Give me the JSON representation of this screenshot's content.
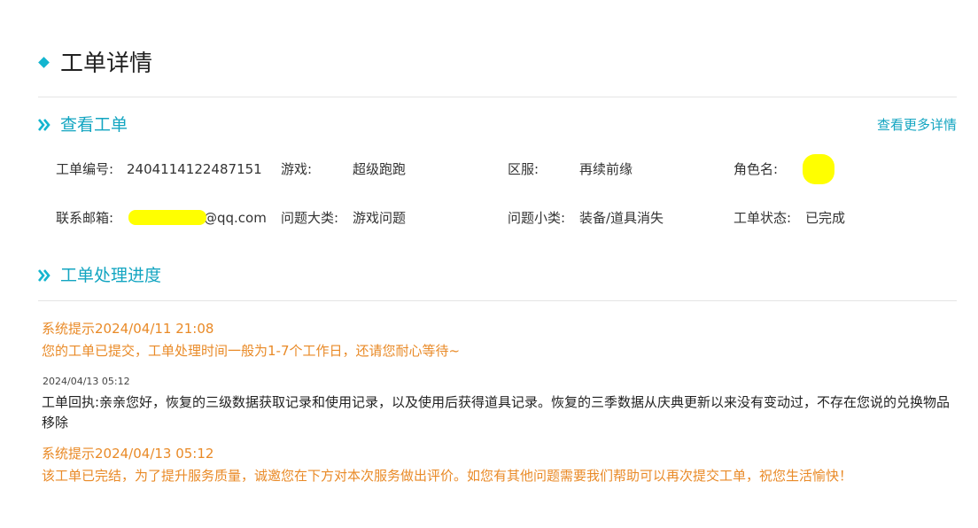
{
  "page": {
    "title": "工单详情"
  },
  "view_section": {
    "title": "查看工单",
    "more_link": "查看更多详情"
  },
  "ticket": {
    "number_label": "工单编号:",
    "number_value": "2404114122487151",
    "game_label": "游戏:",
    "game_value": "超级跑跑",
    "server_label": "区服:",
    "server_value": "再续前缘",
    "role_label": "角色名:",
    "role_value": "",
    "email_label": "联系邮箱:",
    "email_value": "@qq.com",
    "category_label": "问题大类:",
    "category_value": "游戏问题",
    "subcategory_label": "问题小类:",
    "subcategory_value": "装备/道具消失",
    "status_label": "工单状态:",
    "status_value": "已完成"
  },
  "progress_section": {
    "title": "工单处理进度"
  },
  "progress": {
    "entry1": {
      "header": "系统提示2024/04/11 21:08",
      "text": "您的工单已提交，工单处理时间一般为1-7个工作日，还请您耐心等待~"
    },
    "entry2": {
      "timestamp": "2024/04/13 05:12",
      "text": "工单回执:亲亲您好，恢复的三级数据获取记录和使用记录，以及使用后获得道具记录。恢复的三季数据从庆典更新以来没有变动过，不存在您说的兑换物品移除"
    },
    "entry3": {
      "header": "系统提示2024/04/13 05:12",
      "text": "该工单已完结，为了提升服务质量，诚邀您在下方对本次服务做出评价。如您有其他问题需要我们帮助可以再次提交工单，祝您生活愉快！"
    }
  },
  "colors": {
    "accent": "#13a5c1",
    "system": "#e98a27",
    "redaction": "#ffff00"
  }
}
